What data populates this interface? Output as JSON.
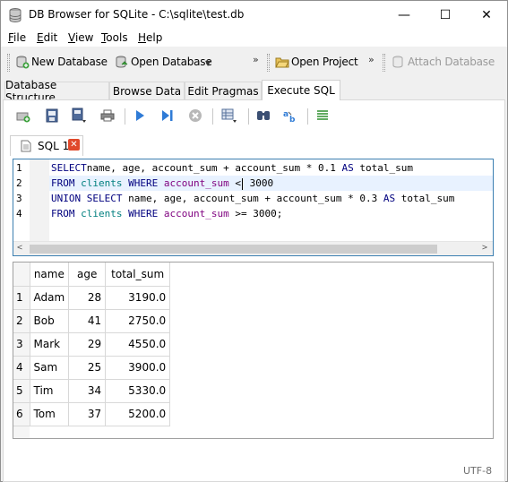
{
  "window": {
    "title": "DB Browser for SQLite - C:\\sqlite\\test.db",
    "minimize": "—",
    "maximize": "☐",
    "close": "✕"
  },
  "menu": [
    "File",
    "Edit",
    "View",
    "Tools",
    "Help"
  ],
  "toolbar": {
    "new_database": "New Database",
    "open_database": "Open Database",
    "open_project": "Open Project",
    "attach_database": "Attach Database",
    "overflow": "»"
  },
  "tabs": [
    "Database Structure",
    "Browse Data",
    "Edit Pragmas",
    "Execute SQL"
  ],
  "active_tab": "Execute SQL",
  "sql_tab": {
    "label": "SQL 1",
    "close": "✕"
  },
  "editor": {
    "line_numbers": [
      "1",
      "2",
      "3",
      "4"
    ],
    "lines": [
      [
        [
          "kw",
          "SELECT"
        ],
        [
          "",
          "name, age, account_sum + account_sum * 0.1 "
        ],
        [
          "kw",
          "AS"
        ],
        [
          "",
          " total_sum"
        ]
      ],
      [
        [
          "kw",
          "FROM"
        ],
        [
          "",
          " "
        ],
        [
          "tbl",
          "clients"
        ],
        [
          "",
          " "
        ],
        [
          "kw",
          "WHERE"
        ],
        [
          "",
          " "
        ],
        [
          "col",
          "account_sum"
        ],
        [
          "",
          " <"
        ],
        [
          "caret",
          ""
        ],
        [
          "",
          " 3000"
        ]
      ],
      [
        [
          "kw",
          "UNION SELECT"
        ],
        [
          "",
          " name, age, account_sum + account_sum * 0.3 "
        ],
        [
          "kw",
          "AS"
        ],
        [
          "",
          " total_sum"
        ]
      ],
      [
        [
          "kw",
          "FROM"
        ],
        [
          "",
          " "
        ],
        [
          "tbl",
          "clients"
        ],
        [
          "",
          " "
        ],
        [
          "kw",
          "WHERE"
        ],
        [
          "",
          " "
        ],
        [
          "col",
          "account_sum"
        ],
        [
          "",
          " >= 3000;"
        ]
      ]
    ]
  },
  "results": {
    "columns": [
      "name",
      "age",
      "total_sum"
    ],
    "rows": [
      {
        "n": "1",
        "name": "Adam",
        "age": "28",
        "total_sum": "3190.0"
      },
      {
        "n": "2",
        "name": "Bob",
        "age": "41",
        "total_sum": "2750.0"
      },
      {
        "n": "3",
        "name": "Mark",
        "age": "29",
        "total_sum": "4550.0"
      },
      {
        "n": "4",
        "name": "Sam",
        "age": "25",
        "total_sum": "3900.0"
      },
      {
        "n": "5",
        "name": "Tim",
        "age": "34",
        "total_sum": "5330.0"
      },
      {
        "n": "6",
        "name": "Tom",
        "age": "37",
        "total_sum": "5200.0"
      }
    ]
  },
  "status": {
    "encoding": "UTF-8"
  },
  "colors": {
    "keyword": "#00007f",
    "table": "#007f7f",
    "column": "#7f007f",
    "close_badge": "#e0492b",
    "editor_border": "#3c7fb1"
  }
}
